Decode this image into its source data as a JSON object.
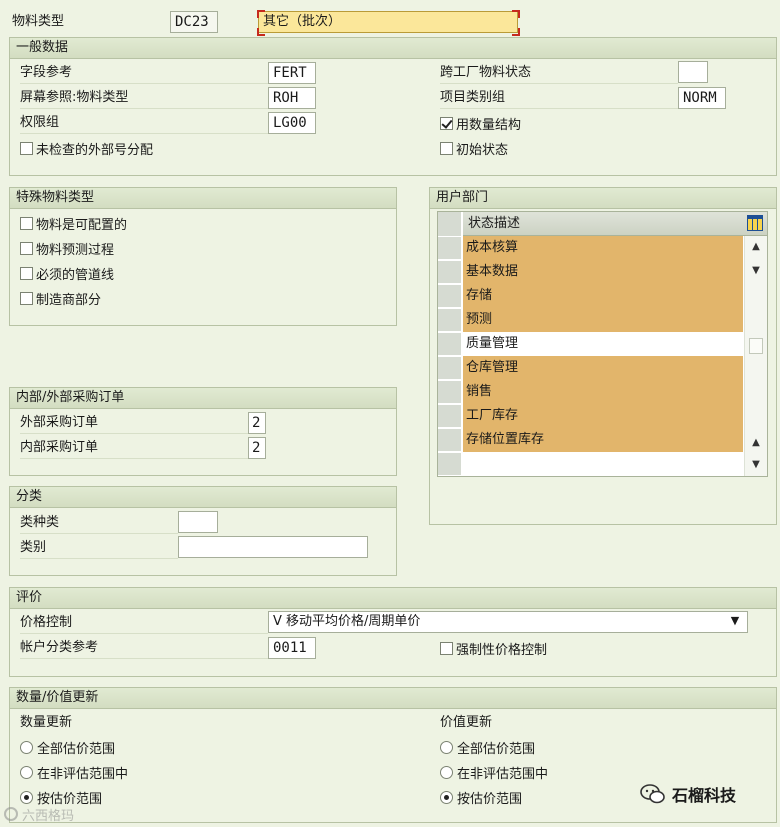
{
  "header": {
    "material_type_label": "物料类型",
    "material_type_value": "DC23",
    "material_type_desc": "其它（批次）"
  },
  "general": {
    "title": "一般数据",
    "field_ref_label": "字段参考",
    "field_ref_value": "FERT",
    "screen_ref_label": "屏幕参照:物料类型",
    "screen_ref_value": "ROH",
    "auth_group_label": "权限组",
    "auth_group_value": "LG00",
    "unchecked_ext_label": "未检查的外部号分配",
    "unchecked_ext_checked": false,
    "cross_plant_label": "跨工厂物料状态",
    "cross_plant_value": "",
    "item_cat_label": "项目类别组",
    "item_cat_value": "NORM",
    "use_qty_struct_label": "用数量结构",
    "use_qty_struct_checked": true,
    "init_status_label": "初始状态",
    "init_status_checked": false
  },
  "special": {
    "title": "特殊物料类型",
    "items": [
      {
        "label": "物料是可配置的",
        "checked": false
      },
      {
        "label": "物料预测过程",
        "checked": false
      },
      {
        "label": "必须的管道线",
        "checked": false
      },
      {
        "label": "制造商部分",
        "checked": false
      }
    ]
  },
  "user_dept": {
    "title": "用户部门",
    "column_header": "状态描述",
    "rows": [
      {
        "label": "成本核算",
        "highlighted": true
      },
      {
        "label": "基本数据",
        "highlighted": true
      },
      {
        "label": "存储",
        "highlighted": true
      },
      {
        "label": "预测",
        "highlighted": true
      },
      {
        "label": "质量管理",
        "highlighted": false
      },
      {
        "label": "仓库管理",
        "highlighted": true
      },
      {
        "label": "销售",
        "highlighted": true
      },
      {
        "label": "工厂库存",
        "highlighted": true
      },
      {
        "label": "存储位置库存",
        "highlighted": true
      },
      {
        "label": "",
        "highlighted": false
      }
    ]
  },
  "purchase": {
    "title": "内部/外部采购订单",
    "external_label": "外部采购订单",
    "external_value": "2",
    "internal_label": "内部采购订单",
    "internal_value": "2"
  },
  "classification": {
    "title": "分类",
    "class_type_label": "类种类",
    "class_type_value": "",
    "class_label": "类别",
    "class_value": ""
  },
  "valuation": {
    "title": "评价",
    "price_control_label": "价格控制",
    "price_control_value": "V 移动平均价格/周期单价",
    "acct_cat_label": "帐户分类参考",
    "acct_cat_value": "0011",
    "forced_price_label": "强制性价格控制",
    "forced_price_checked": false
  },
  "update": {
    "title": "数量/价值更新",
    "qty_title": "数量更新",
    "val_title": "价值更新",
    "options": [
      "全部估价范围",
      "在非评估范围中",
      "按估价范围"
    ],
    "qty_selected": 2,
    "val_selected": 2
  },
  "watermarks": {
    "left": "六西格玛",
    "right": "石榴科技"
  },
  "colors": {
    "background": "#eef3e3",
    "highlight": "#e2b56b",
    "required_field": "#fbe79a"
  }
}
